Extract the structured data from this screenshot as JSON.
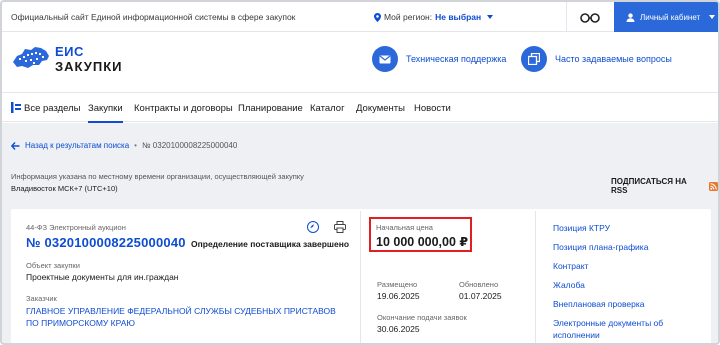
{
  "topbar": {
    "site_caption": "Официальный сайт Единой информационной системы в сфере закупок",
    "region_label": "Мой регион:",
    "region_value": "Не выбран",
    "cabinet_label": "Личный кабинет"
  },
  "header": {
    "logo_line1": "ЕИС",
    "logo_line2": "ЗАКУПКИ",
    "support_link": "Техническая поддержка",
    "faq_link": "Часто задаваемые вопросы"
  },
  "nav": {
    "items": [
      "Все разделы",
      "Закупки",
      "Контракты и договоры",
      "Планирование",
      "Каталог",
      "Документы",
      "Новости"
    ],
    "active": "Закупки"
  },
  "breadcrumb": {
    "back_label": "Назад к результатам поиска",
    "current": "№ 0320100008225000040"
  },
  "info": {
    "timezone_note": "Информация указана по местному времени организации, осуществляющей закупку",
    "timezone_value": "Владивосток МСК+7 (UTC+10)",
    "rss_label": "ПОДПИСАТЬСЯ НА RSS"
  },
  "procurement": {
    "law_type": "44-ФЗ Электронный аукцион",
    "number": "№ 0320100008225000040",
    "status": "Определение поставщика завершено",
    "object_label": "Объект закупки",
    "object_value": "Проектные документы для ин.граждан",
    "customer_label": "Заказчик",
    "customer_value": "ГЛАВНОЕ УПРАВЛЕНИЕ ФЕДЕРАЛЬНОЙ СЛУЖБЫ СУДЕБНЫХ ПРИСТАВОВ ПО ПРИМОРСКОМУ КРАЮ",
    "price_label": "Начальная цена",
    "price_value": "10 000 000,00 ₽",
    "posted_label": "Размещено",
    "posted_value": "19.06.2025",
    "updated_label": "Обновлено",
    "updated_value": "01.07.2025",
    "deadline_label": "Окончание подачи заявок",
    "deadline_value": "30.06.2025"
  },
  "side_links": [
    "Позиция КТРУ",
    "Позиция плана-графика",
    "Контракт",
    "Жалоба",
    "Внеплановая проверка",
    "Электронные документы об",
    "исполнении"
  ],
  "colors": {
    "accent": "#0d4cd3",
    "button": "#2b68d9",
    "highlight": "#e02020",
    "background": "#eef0f3"
  },
  "icons": [
    "map-pin-icon",
    "glasses-icon",
    "user-icon",
    "mail-icon",
    "windows-icon",
    "menu-icon",
    "arrow-left-icon",
    "rss-icon",
    "compass-icon",
    "print-icon"
  ]
}
